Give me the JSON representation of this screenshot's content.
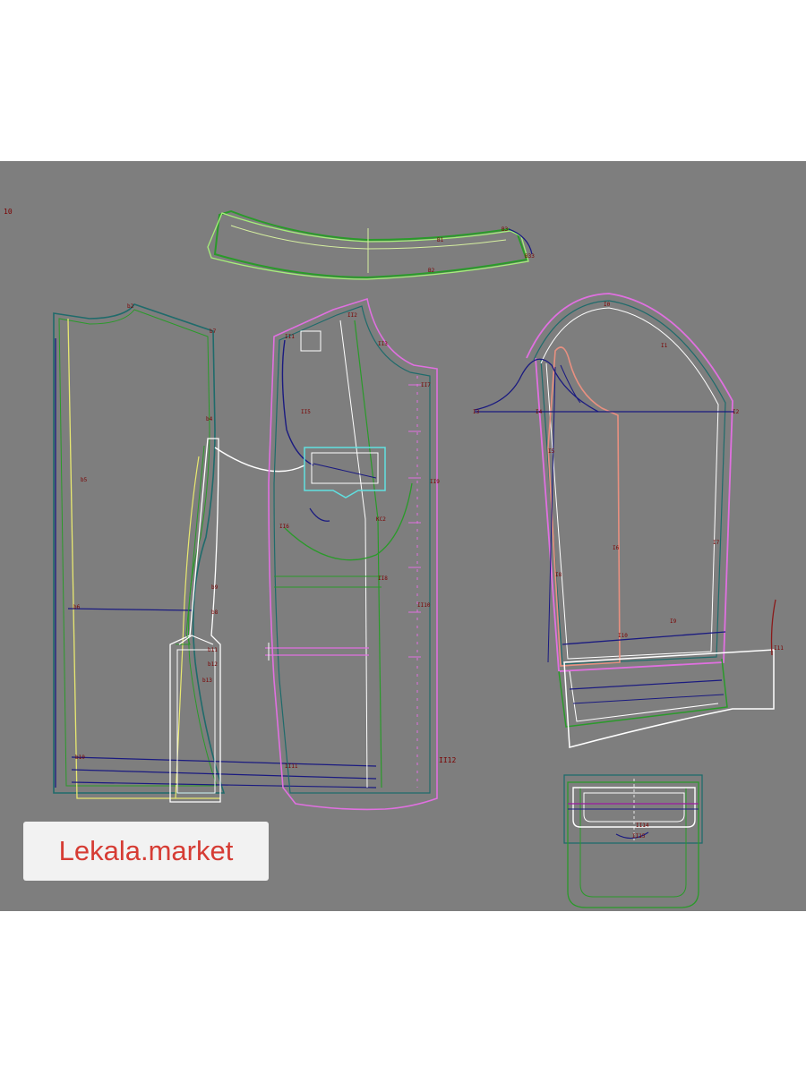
{
  "watermark": {
    "text": "Lekala.market"
  },
  "corner_mark": "10",
  "colors": {
    "background": "#7e7e7e",
    "teal": "#1f6b6b",
    "green": "#1a8a2a",
    "pink": "#e070e0",
    "white": "#ffffff",
    "yellow": "#e8e870",
    "navy": "#1a1a80",
    "cyan": "#60e0e0",
    "salmon": "#e89080",
    "label": "#7a0000",
    "watermark_text": "#d63c34"
  },
  "pieces": {
    "collar": {
      "labels": [
        "B3",
        "B2",
        "B1",
        "B33"
      ]
    },
    "back": {
      "labels": [
        "b2",
        "b4",
        "b5",
        "b6",
        "b10",
        "b7"
      ]
    },
    "side_panel": {
      "labels": [
        "b9",
        "b8",
        "b11",
        "b12",
        "b13"
      ]
    },
    "front": {
      "labels": [
        "II2",
        "II1",
        "II3",
        "II5",
        "II6",
        "II7",
        "KC2",
        "II8",
        "II9",
        "II10",
        "II11",
        "II12"
      ]
    },
    "sleeve": {
      "labels": [
        "I0",
        "I1",
        "I2",
        "I3",
        "I4",
        "I5",
        "I6",
        "I7",
        "I8",
        "I9",
        "I10",
        "I11"
      ]
    },
    "pocket": {
      "labels": [
        "II14",
        "II15"
      ]
    }
  }
}
